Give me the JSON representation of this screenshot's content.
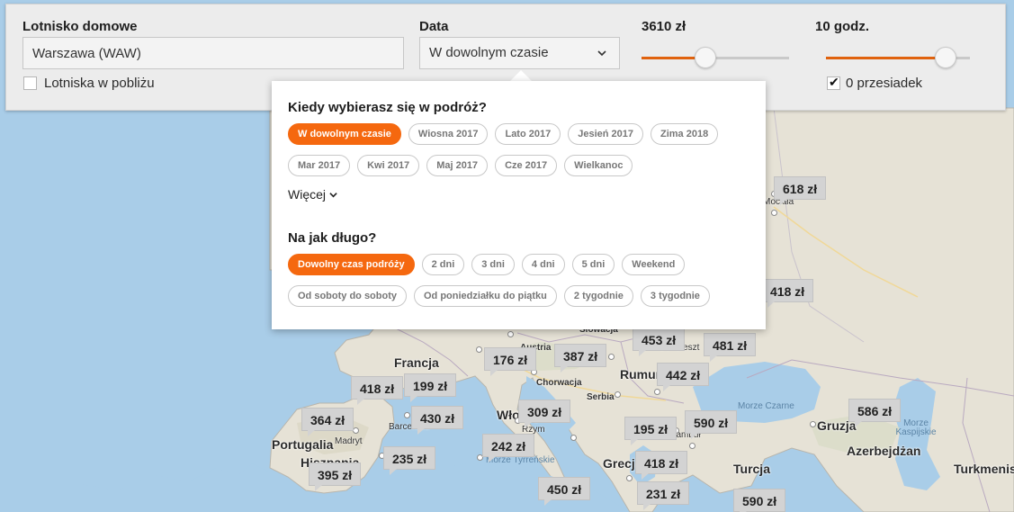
{
  "filters": {
    "origin_label": "Lotnisko domowe",
    "origin_value": "Warszawa (WAW)",
    "nearby_label": "Lotniska w pobliżu",
    "nearby_checked": false,
    "date_label": "Data",
    "date_value": "W dowolnym czasie",
    "price_label": "3610 zł",
    "price_slider_fraction": 0.43,
    "duration_label": "10 godz.",
    "duration_slider_fraction": 0.83,
    "stops_label": "0 przesiadek",
    "stops_checked": true
  },
  "popup": {
    "when_heading": "Kiedy wybierasz się w podróż?",
    "when_chips_row1": [
      "W dowolnym czasie",
      "Wiosna 2017",
      "Lato 2017",
      "Jesień 2017",
      "Zima 2018"
    ],
    "when_chips_row2": [
      "Mar 2017",
      "Kwi 2017",
      "Maj 2017",
      "Cze 2017",
      "Wielkanoc"
    ],
    "when_active": "W dowolnym czasie",
    "more_label": "Więcej",
    "duration_heading": "Na jak długo?",
    "duration_chips_row1": [
      "Dowolny czas podróży",
      "2 dni",
      "3 dni",
      "4 dni",
      "5 dni",
      "Weekend"
    ],
    "duration_chips_row2": [
      "Od soboty do soboty",
      "Od poniedziałku do piątku",
      "2 tygodnie",
      "3 tygodnie"
    ],
    "duration_active": "Dowolny czas podróży"
  },
  "map": {
    "country_labels": [
      "Francja",
      "Portugalia",
      "Hiszpania",
      "Włochy",
      "Grecja",
      "Turcja",
      "Rumunia",
      "Gruzja",
      "Azerbejdżan",
      "Turkmenistan",
      "Słowacja",
      "Austria",
      "Chorwacja",
      "Serbia"
    ],
    "city_labels": [
      "Madryt",
      "Barcelona",
      "Rzym",
      "Stambuł",
      "Bukareszt",
      "Москва"
    ],
    "sea_labels": [
      "Morze Czarne",
      "Morze Kaspijskie",
      "Morze Tyrreńskie"
    ],
    "prices": [
      "618 zł",
      "418 zł",
      "453 zł",
      "481 zł",
      "176 zł",
      "387 zł",
      "442 zł",
      "418 zł",
      "199 zł",
      "364 zł",
      "430 zł",
      "309 zł",
      "195 zł",
      "590 zł",
      "586 zł",
      "242 zł",
      "235 zł",
      "395 zł",
      "418 zł",
      "450 zł",
      "231 zł",
      "590 zł"
    ]
  }
}
